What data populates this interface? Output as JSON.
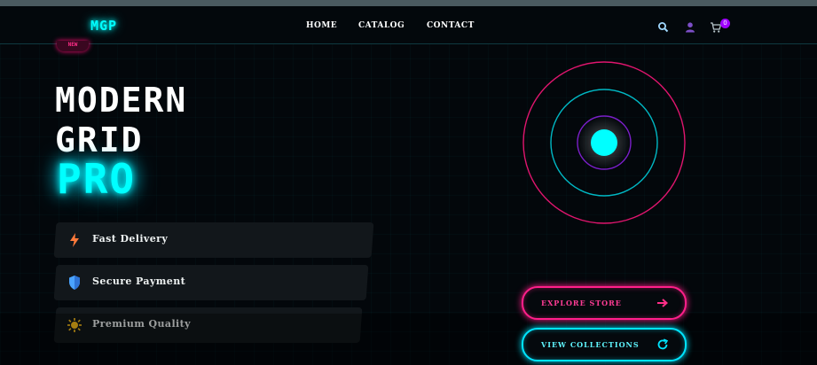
{
  "brand": {
    "logo": "MGP"
  },
  "nav": {
    "links": [
      "HOME",
      "CATALOG",
      "CONTACT"
    ],
    "icons": [
      "search-icon",
      "user-icon",
      "cart-icon"
    ],
    "cart_count": "0"
  },
  "badge": {
    "label": "NEW"
  },
  "hero": {
    "line1": "MODERN",
    "line2": "GRID",
    "accent": "PRO"
  },
  "features": [
    {
      "label": "Fast Delivery",
      "icon": "lightning-icon"
    },
    {
      "label": "Secure Payment",
      "icon": "shield-icon"
    },
    {
      "label": "Premium Quality",
      "icon": "sun-icon"
    }
  ],
  "buttons": {
    "explore": {
      "label": "EXPLORE STORE",
      "icon": "arrow-right-icon"
    },
    "view": {
      "label": "VIEW COLLECTIONS",
      "icon": "refresh-icon"
    }
  },
  "colors": {
    "accent_cyan": "#00ffff",
    "accent_pink": "#ff1f8a",
    "accent_purple": "#a000ff",
    "background": "#03070b"
  }
}
